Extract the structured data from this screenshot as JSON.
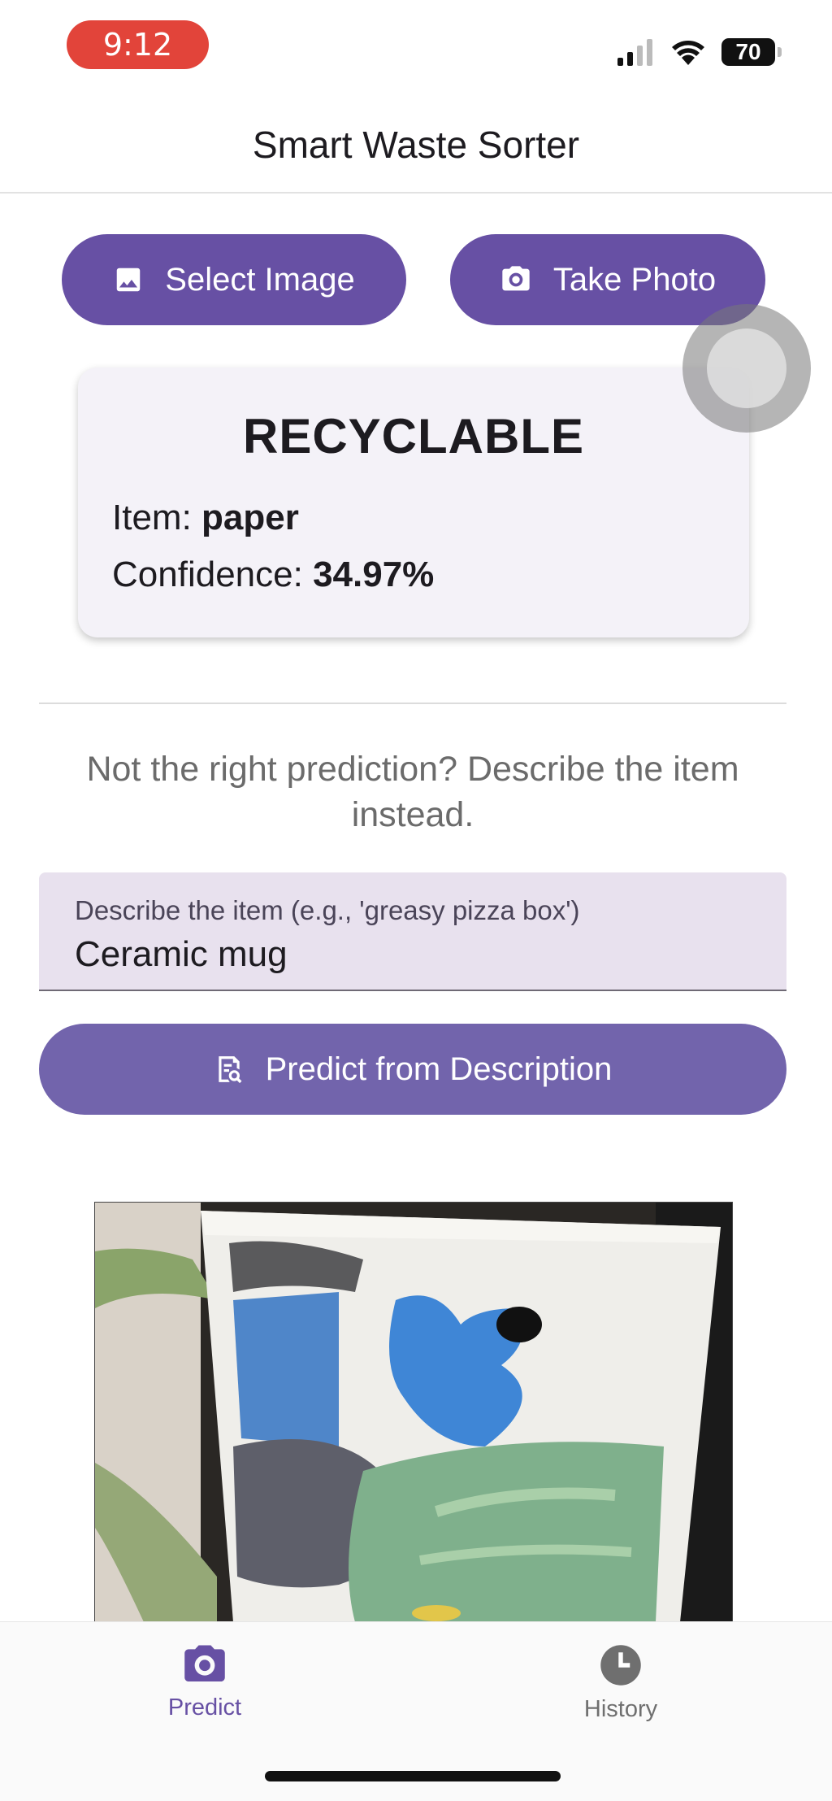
{
  "status_bar": {
    "time": "9:12",
    "battery": "70"
  },
  "app_bar": {
    "title": "Smart Waste Sorter"
  },
  "actions": {
    "select_image": "Select Image",
    "take_photo": "Take Photo"
  },
  "result": {
    "category": "RECYCLABLE",
    "item_label": "Item: ",
    "item_value": "paper",
    "confidence_label": "Confidence: ",
    "confidence_value": "34.97%"
  },
  "feedback": {
    "hint": "Not the right prediction? Describe the item instead.",
    "input_label": "Describe the item (e.g., 'greasy pizza box')",
    "input_value": "Ceramic mug",
    "predict_button": "Predict from Description"
  },
  "bottom_nav": {
    "items": [
      {
        "label": "Predict",
        "icon": "camera-icon",
        "active": true
      },
      {
        "label": "History",
        "icon": "clock-icon",
        "active": false
      }
    ]
  },
  "colors": {
    "primary": "#6750a4",
    "primary_button": "#7264ac",
    "card_bg": "#f4f2f8",
    "field_bg": "#e8e1ee"
  }
}
